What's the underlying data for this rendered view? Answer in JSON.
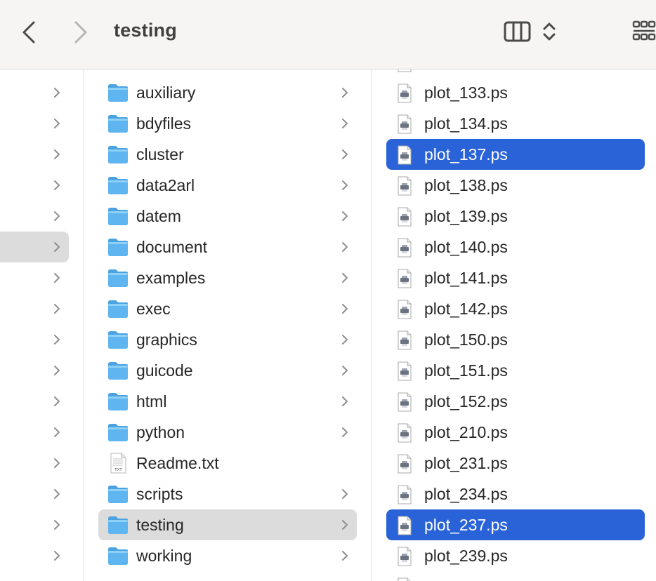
{
  "window": {
    "title": "testing",
    "icons": {
      "back": "chevron-left-icon",
      "forward": "chevron-right-icon",
      "column_view": "column-view-icon",
      "view_switch": "up-down-chevron-icon",
      "group": "grid-icon"
    }
  },
  "sidebar_column": {
    "row_count": 16,
    "selected_index": 5
  },
  "folder_column": {
    "items": [
      {
        "label": "auxiliary",
        "kind": "folder"
      },
      {
        "label": "bdyfiles",
        "kind": "folder"
      },
      {
        "label": "cluster",
        "kind": "folder"
      },
      {
        "label": "data2arl",
        "kind": "folder"
      },
      {
        "label": "datem",
        "kind": "folder"
      },
      {
        "label": "document",
        "kind": "folder"
      },
      {
        "label": "examples",
        "kind": "folder"
      },
      {
        "label": "exec",
        "kind": "folder"
      },
      {
        "label": "graphics",
        "kind": "folder"
      },
      {
        "label": "guicode",
        "kind": "folder"
      },
      {
        "label": "html",
        "kind": "folder"
      },
      {
        "label": "python",
        "kind": "folder"
      },
      {
        "label": "Readme.txt",
        "kind": "text-file"
      },
      {
        "label": "scripts",
        "kind": "folder"
      },
      {
        "label": "testing",
        "kind": "folder",
        "selected": true
      },
      {
        "label": "working",
        "kind": "folder"
      }
    ]
  },
  "file_column": {
    "items": [
      {
        "label": "plot_133.ps"
      },
      {
        "label": "plot_134.ps"
      },
      {
        "label": "plot_137.ps",
        "selected": true
      },
      {
        "label": "plot_138.ps"
      },
      {
        "label": "plot_139.ps"
      },
      {
        "label": "plot_140.ps"
      },
      {
        "label": "plot_141.ps"
      },
      {
        "label": "plot_142.ps"
      },
      {
        "label": "plot_150.ps"
      },
      {
        "label": "plot_151.ps"
      },
      {
        "label": "plot_152.ps"
      },
      {
        "label": "plot_210.ps"
      },
      {
        "label": "plot_231.ps"
      },
      {
        "label": "plot_234.ps"
      },
      {
        "label": "plot_237.ps",
        "selected": true
      },
      {
        "label": "plot_239.ps"
      }
    ]
  },
  "colors": {
    "toolbar_bg": "#f6f5f4",
    "selection_blue": "#2a62d8",
    "selection_gray": "#dcdcdc",
    "folder_blue": "#5eb5f0"
  }
}
